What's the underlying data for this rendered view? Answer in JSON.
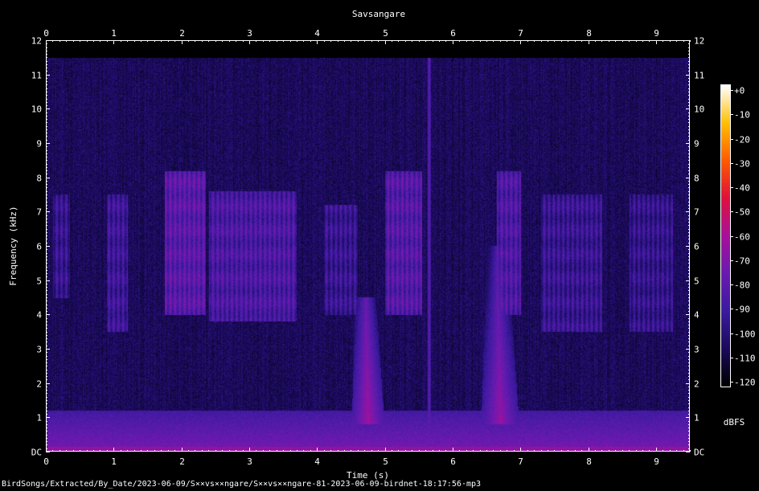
{
  "chart_data": {
    "type": "heatmap",
    "title": "Savsangare",
    "xlabel": "Time (s)",
    "ylabel": "Frequency (kHz)",
    "xlim": [
      0,
      9.5
    ],
    "ylim": [
      0,
      12
    ],
    "x_ticks": [
      "0",
      "1",
      "2",
      "3",
      "4",
      "5",
      "6",
      "7",
      "8",
      "9"
    ],
    "y_ticks": [
      "DC",
      "1",
      "2",
      "3",
      "4",
      "5",
      "6",
      "7",
      "8",
      "9",
      "10",
      "11",
      "12"
    ],
    "colorbar": {
      "label": "dBFS",
      "range": [
        -120,
        0
      ],
      "ticks": [
        "+0",
        "-10",
        "-20",
        "-30",
        "-40",
        "-50",
        "-60",
        "-70",
        "-80",
        "-90",
        "-100",
        "-110",
        "-120"
      ],
      "colors": [
        "#000000",
        "#1a0a5c",
        "#3c1aa0",
        "#6a1ab0",
        "#a8109a",
        "#e0103c",
        "#ff5a00",
        "#ffc000",
        "#ffffff"
      ]
    },
    "energy_limit_khz": 11.5,
    "events": [
      {
        "name": "sweep",
        "t": 4.75,
        "f_low": 0.8,
        "f_high": 4.5,
        "db": -62
      },
      {
        "name": "sweep",
        "t": 6.7,
        "f_low": 0.8,
        "f_high": 6.0,
        "db": -64
      },
      {
        "name": "click",
        "t": 5.65,
        "f_low": 0.0,
        "f_high": 12.0,
        "db": -75
      }
    ],
    "bursts": [
      {
        "t0": 0.1,
        "t1": 0.35,
        "f_low": 4.5,
        "f_high": 7.5,
        "db": -82
      },
      {
        "t0": 0.9,
        "t1": 1.2,
        "f_low": 3.5,
        "f_high": 7.5,
        "db": -80
      },
      {
        "t0": 1.75,
        "t1": 2.35,
        "f_low": 4.0,
        "f_high": 8.2,
        "db": -70
      },
      {
        "t0": 2.4,
        "t1": 3.7,
        "f_low": 3.8,
        "f_high": 7.6,
        "db": -75
      },
      {
        "t0": 4.1,
        "t1": 4.6,
        "f_low": 4.0,
        "f_high": 7.2,
        "db": -82
      },
      {
        "t0": 5.0,
        "t1": 5.55,
        "f_low": 4.0,
        "f_high": 8.2,
        "db": -72
      },
      {
        "t0": 6.65,
        "t1": 7.0,
        "f_low": 4.0,
        "f_high": 8.2,
        "db": -74
      },
      {
        "t0": 7.3,
        "t1": 8.2,
        "f_low": 3.5,
        "f_high": 7.5,
        "db": -82
      },
      {
        "t0": 8.6,
        "t1": 9.25,
        "f_low": 3.5,
        "f_high": 7.5,
        "db": -84
      }
    ]
  },
  "footer": {
    "path": "BirdSongs/Extracted/By_Date/2023-06-09/S××vs××ngare/S××vs××ngare-81-2023-06-09-birdnet-18:17:56·mp3"
  }
}
